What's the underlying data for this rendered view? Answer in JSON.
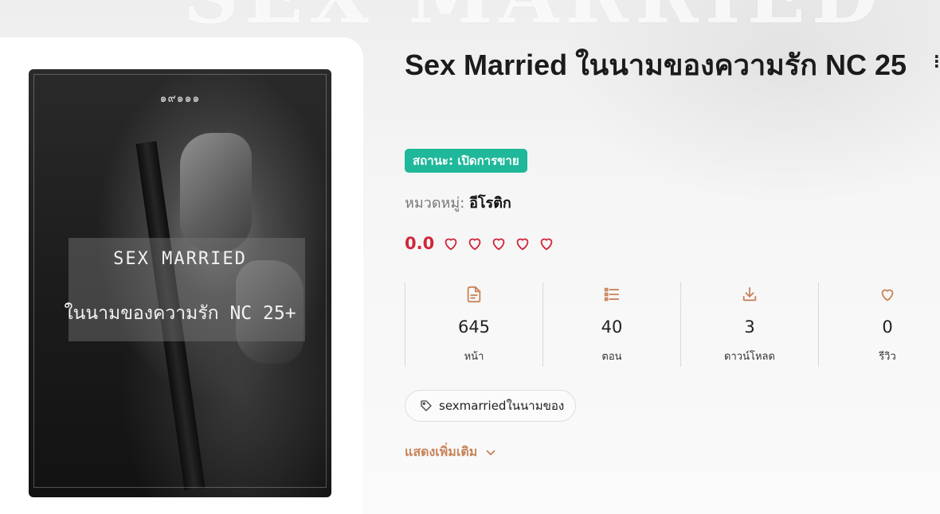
{
  "background": {
    "watermark": "SEX MARRIED"
  },
  "cover": {
    "ornament": "๑๙๑๑๑",
    "title_line1": "SEX MARRIED",
    "title_line2": "ในนามของความรัก NC 25+"
  },
  "book": {
    "title": "Sex Married ในนามของความรัก NC 25",
    "status": "สถานะ: เปิดการขาย",
    "category_label": "หมวดหมู่:",
    "category_value": "อีโรติก",
    "rating_score": "0.0",
    "rating_max": 5,
    "rating_hearts_filled": 0
  },
  "stats": [
    {
      "icon": "document-icon",
      "value": "645",
      "label": "หน้า"
    },
    {
      "icon": "list-icon",
      "value": "40",
      "label": "ตอน"
    },
    {
      "icon": "download-icon",
      "value": "3",
      "label": "ดาวน์โหลด"
    },
    {
      "icon": "heart-icon",
      "value": "0",
      "label": "รีวิว"
    }
  ],
  "tags": [
    {
      "icon": "tag-icon",
      "label": "sexmarriedในนามของ"
    }
  ],
  "show_more": {
    "label": "แสดงเพิ่มเติม",
    "icon": "chevron-down-icon"
  },
  "colors": {
    "accent": "#c8845a",
    "status_green": "#1fb89a",
    "rating_red": "#d0283a"
  }
}
